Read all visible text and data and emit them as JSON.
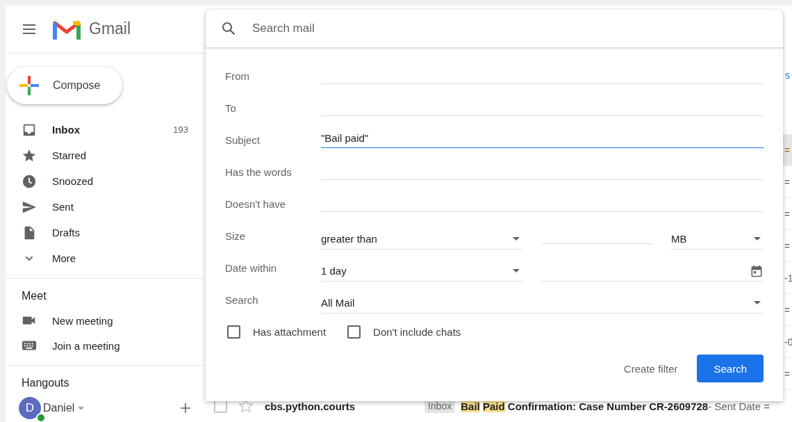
{
  "header": {
    "app_name": "Gmail"
  },
  "compose": {
    "label": "Compose"
  },
  "nav": [
    {
      "kind": "inbox",
      "label": "Inbox",
      "count": "193",
      "unread": true
    },
    {
      "kind": "star",
      "label": "Starred",
      "unread": false
    },
    {
      "kind": "clock",
      "label": "Snoozed",
      "unread": false
    },
    {
      "kind": "send",
      "label": "Sent",
      "unread": false
    },
    {
      "kind": "file",
      "label": "Drafts",
      "unread": false
    },
    {
      "kind": "more",
      "label": "More",
      "unread": false
    }
  ],
  "meet": {
    "title": "Meet",
    "items": [
      {
        "kind": "video",
        "label": "New meeting"
      },
      {
        "kind": "keyboard",
        "label": "Join a meeting"
      }
    ]
  },
  "hangouts": {
    "title": "Hangouts",
    "user": {
      "initial": "D",
      "name": "Daniel",
      "online": true
    }
  },
  "background": {
    "toolbar_fragment": "s",
    "row_fragments": [
      {
        "text": "=",
        "highlighted": true
      },
      {
        "text": "=",
        "highlighted": false
      },
      {
        "text": "=",
        "highlighted": false
      },
      {
        "text": "=",
        "highlighted": false
      },
      {
        "text": "-1",
        "highlighted": false
      },
      {
        "text": "=",
        "highlighted": false
      },
      {
        "text": "-0",
        "highlighted": false
      },
      {
        "text": "=",
        "highlighted": false
      }
    ],
    "email": {
      "checked": false,
      "sender": "cbs.python.courts",
      "label": "Inbox",
      "subject": [
        {
          "text": "Bail",
          "highlight": true
        },
        {
          "text": "Paid",
          "highlight": true
        },
        {
          "text": "Confirmation: Case Number CR-2609728",
          "highlight": false
        }
      ],
      "snippet": "- Sent Date ="
    }
  },
  "search": {
    "placeholder": "Search mail",
    "fields": [
      {
        "kind": "text",
        "label": "From",
        "focused": false
      },
      {
        "kind": "text",
        "label": "To",
        "focused": false
      },
      {
        "kind": "text",
        "label": "Subject",
        "value": "\"Bail paid\"",
        "focused": true
      },
      {
        "kind": "text",
        "label": "Has the words",
        "focused": false
      },
      {
        "kind": "text",
        "label": "Doesn't have",
        "focused": false
      },
      {
        "kind": "size",
        "label": "Size",
        "operator": "greater than",
        "unit": "MB"
      },
      {
        "kind": "date",
        "label": "Date within",
        "range": "1 day"
      },
      {
        "kind": "select",
        "label": "Search",
        "value": "All Mail"
      }
    ],
    "checkboxes": [
      {
        "label": "Has attachment",
        "checked": false
      },
      {
        "label": "Don't include chats",
        "checked": false
      }
    ],
    "buttons": [
      {
        "kind": "text",
        "label": "Create filter"
      },
      {
        "kind": "primary",
        "label": "Search"
      }
    ]
  }
}
